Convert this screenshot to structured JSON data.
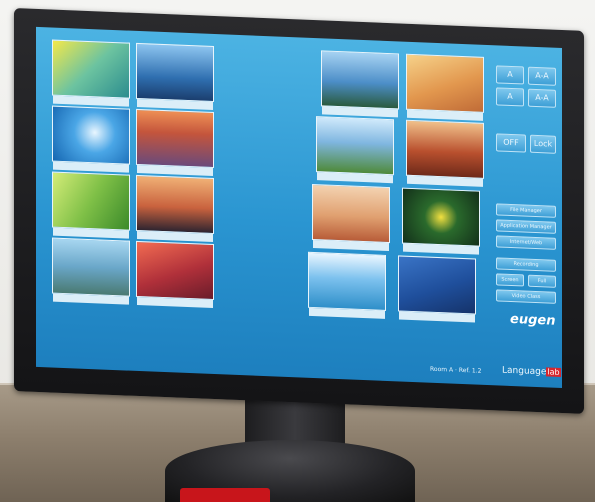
{
  "screen": {
    "panel_buttons": [
      "A",
      "A-A",
      "A",
      "A-A",
      "OFF",
      "Lock",
      "File Manager",
      "Application Manager",
      "Internet/Web",
      "Recording",
      "Screen",
      "Full",
      "Video Class"
    ],
    "brand": "eugen",
    "lang_text": "Language",
    "lang_badge": "lab",
    "room_text": "Room A · Ref. 1.2"
  },
  "colors": {
    "screen_bg": "#2a95d1",
    "bezel": "#1d1d1f",
    "badge_red": "#d7262d"
  }
}
